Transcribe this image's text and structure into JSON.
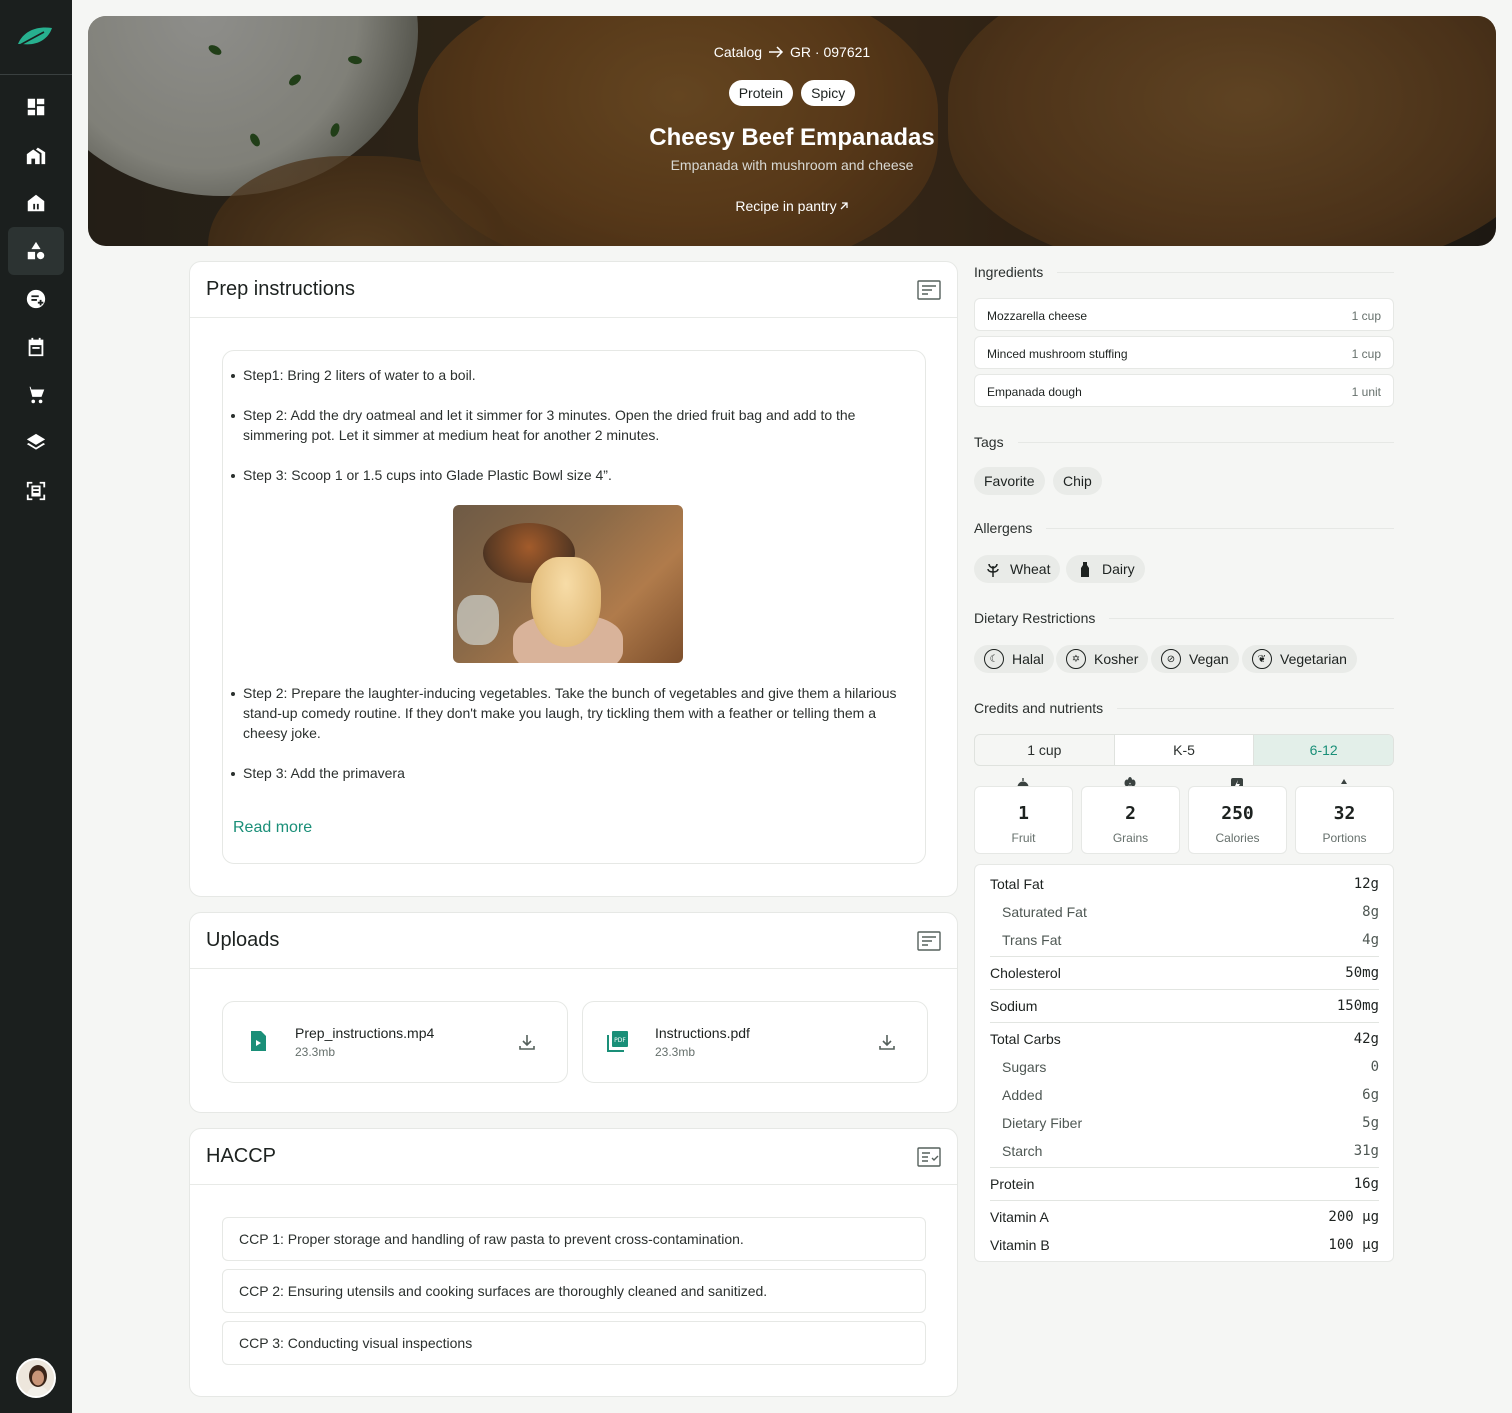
{
  "hero": {
    "breadcrumb_root": "Catalog",
    "breadcrumb_code": "GR · 097621",
    "tags": [
      "Protein",
      "Spicy"
    ],
    "title": "Cheesy Beef Empanadas",
    "subtitle": "Empanada with mushroom and cheese",
    "pantry_link": "Recipe in pantry"
  },
  "sidebar": {
    "items": [
      {
        "icon": "dashboard-icon"
      },
      {
        "icon": "buildings-icon"
      },
      {
        "icon": "store-icon"
      },
      {
        "icon": "shapes-icon",
        "active": true
      },
      {
        "icon": "add-list-icon"
      },
      {
        "icon": "calendar-icon"
      },
      {
        "icon": "cart-icon"
      },
      {
        "icon": "layers-icon"
      },
      {
        "icon": "scan-document-icon"
      }
    ]
  },
  "prep": {
    "title": "Prep instructions",
    "steps_before": [
      "Step1: Bring 2 liters of water to a boil.",
      "Step 2: Add the dry oatmeal and let it simmer for 3 minutes. Open the dried fruit bag and add to the simmering pot. Let it simmer at medium heat for another 2 minutes.",
      "Step 3: Scoop 1 or 1.5 cups into Glade Plastic Bowl size 4”."
    ],
    "steps_after": [
      "Step 2: Prepare the laughter-inducing vegetables. Take the bunch of vegetables and give them a hilarious stand-up comedy routine. If they don't make you laugh, try tickling them with a feather or telling them a cheesy joke.",
      "Step 3: Add the primavera"
    ],
    "read_more": "Read more"
  },
  "uploads": {
    "title": "Uploads",
    "files": [
      {
        "name": "Prep_instructions.mp4",
        "size": "23.3mb",
        "icon": "video-file-icon"
      },
      {
        "name": "Instructions.pdf",
        "size": "23.3mb",
        "icon": "pdf-file-icon"
      }
    ]
  },
  "haccp": {
    "title": "HACCP",
    "items": [
      "CCP 1: Proper storage and handling of raw pasta to prevent cross-contamination.",
      "CCP 2: Ensuring utensils and cooking surfaces are thoroughly cleaned and sanitized.",
      "CCP 3: Conducting visual inspections"
    ]
  },
  "ingredients": {
    "title": "Ingredients",
    "items": [
      {
        "name": "Mozzarella cheese",
        "qty": "1 cup"
      },
      {
        "name": "Minced mushroom stuffing",
        "qty": "1 cup"
      },
      {
        "name": "Empanada dough",
        "qty": "1 unit"
      }
    ]
  },
  "tags": {
    "title": "Tags",
    "items": [
      "Favorite",
      "Chip"
    ]
  },
  "allergens": {
    "title": "Allergens",
    "items": [
      "Wheat",
      "Dairy"
    ]
  },
  "dietary": {
    "title": "Dietary Restrictions",
    "items": [
      "Halal",
      "Kosher",
      "Vegan",
      "Vegetarian"
    ]
  },
  "credits": {
    "title": "Credits and nutrients",
    "segments": [
      "1 cup",
      "K-5",
      "6-12"
    ],
    "selected_segment": "6-12",
    "stats": [
      {
        "value": "1",
        "label": "Fruit",
        "icon": "apple-icon"
      },
      {
        "value": "2",
        "label": "Grains",
        "icon": "wheat-icon"
      },
      {
        "value": "250",
        "label": "Calories",
        "icon": "energy-icon"
      },
      {
        "value": "32",
        "label": "Portions",
        "icon": "shapes-icon"
      }
    ]
  },
  "nutrients": [
    {
      "name": "Total Fat",
      "value": "12g"
    },
    {
      "name": "Saturated Fat",
      "value": "8g",
      "sub": true
    },
    {
      "name": "Trans Fat",
      "value": "4g",
      "sub": true
    },
    {
      "name": "Cholesterol",
      "value": "50mg"
    },
    {
      "name": "Sodium",
      "value": "150mg"
    },
    {
      "name": "Total Carbs",
      "value": "42g"
    },
    {
      "name": "Sugars",
      "value": "0",
      "sub": true
    },
    {
      "name": "Added",
      "value": "6g",
      "sub": true
    },
    {
      "name": "Dietary Fiber",
      "value": "5g",
      "sub": true
    },
    {
      "name": "Starch",
      "value": "31g",
      "sub": true
    },
    {
      "name": "Protein",
      "value": "16g"
    },
    {
      "name": "Vitamin A",
      "value": "200 µg"
    },
    {
      "name": "Vitamin B",
      "value": "100 µg"
    }
  ],
  "colors": {
    "accent": "#1a8f78",
    "sidebar": "#1b1f1e",
    "background": "#f5f6f4"
  }
}
